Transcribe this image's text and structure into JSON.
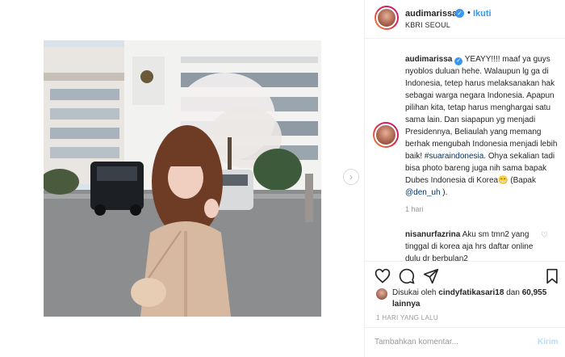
{
  "post": {
    "username": "audimarissa",
    "follow_label": "Ikuti",
    "separator": "•",
    "location": "KBRI SEOUL"
  },
  "caption": {
    "username": "audimarissa",
    "text_part1": " YEAYY!!!! maaf ya guys nyoblos duluan hehe. Walaupun lg ga di Indonesia, tetep harus melaksanakan hak sebagai warga negara Indonesia. Apapun pilihan kita, tetap harus menghargai satu sama lain. Dan siapapun yg menjadi Presidennya, Beliaulah yang memang berhak mengubah Indonesia menjadi lebih baik! ",
    "hashtag": "#suaraindonesia",
    "text_part2": ". Ohya sekalian tadi bisa photo bareng juga nih sama bapak Dubes Indonesia di Korea😁 (Bapak ",
    "mention": "@den_uh",
    "text_part3": " ).",
    "time": "1 hari"
  },
  "comment2": {
    "username": "nisanurfazrina",
    "text": " Aku sm tmn2 yang tinggal di korea aja hrs daftar online dulu dr berbulan2"
  },
  "likes": {
    "prefix": "Disukai oleh ",
    "liker": "cindyfatikasari18",
    "middle": " dan ",
    "count": "60,955",
    "suffix": " lainnya"
  },
  "timestamp": "1 HARI YANG LALU",
  "comment_input": {
    "placeholder": "Tambahkan komentar...",
    "post_label": "Kirim"
  },
  "icons": {
    "verified": "verified-badge-icon",
    "next": "chevron-right-icon",
    "heart": "heart-icon",
    "comment": "comment-icon",
    "share": "share-icon",
    "save": "bookmark-icon"
  },
  "colors": {
    "accent": "#3897f0",
    "hashtag": "#003569",
    "muted": "#999999"
  }
}
